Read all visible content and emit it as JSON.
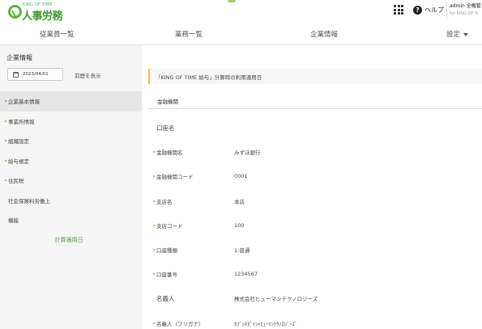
{
  "header": {
    "logo_small": "KING OF TIME",
    "logo_name": "人事労務",
    "help_label": "ヘルプ",
    "user_name": "admin 全権管",
    "user_sub": "for KING OF TI"
  },
  "nav": {
    "items": [
      "従業員一覧",
      "業務一覧",
      "企業情報",
      "設定"
    ]
  },
  "sidebar": {
    "title": "企業情報",
    "date": "2023/04/01",
    "past_link": "前歴を表示",
    "items": [
      {
        "label": "企業基本情報",
        "required": true,
        "active": true
      },
      {
        "label": "事業所情報",
        "required": true,
        "active": false
      },
      {
        "label": "組織設定",
        "required": true,
        "active": false
      },
      {
        "label": "給与規定",
        "required": true,
        "active": false
      },
      {
        "label": "住民税",
        "required": true,
        "active": false
      },
      {
        "label": "社会保険料労働上",
        "required": false,
        "active": false
      },
      {
        "label": "機能",
        "required": false,
        "active": false
      }
    ],
    "apply_link": "計算適用日"
  },
  "main": {
    "notice": "「KING OF TIME 給与」計算時の利用適用日",
    "section_title": "金融機関",
    "fields": [
      {
        "label": "口座名",
        "value": "",
        "required": false
      },
      {
        "label": "金融機関名",
        "value": "みずほ銀行",
        "required": true
      },
      {
        "label": "金融機関コード",
        "value": "0001",
        "required": true
      },
      {
        "label": "支店名",
        "value": "本店",
        "required": true
      },
      {
        "label": "支店コード",
        "value": "100",
        "required": true
      },
      {
        "label": "口座種類",
        "value": "1:普通",
        "required": true
      },
      {
        "label": "口座番号",
        "value": "1234567",
        "required": true
      },
      {
        "label": "名義人",
        "value": "株式会社ヒューマンテクノロジーズ",
        "required": false
      },
      {
        "label": "名義人（フリガナ）",
        "value": "ｶﾌﾞｼｷｶﾞｲｼｬﾋｭｰﾏﾝﾃｸﾉﾛｼﾞｰｽﾞ",
        "required": true
      }
    ]
  },
  "colors": {
    "brand_green": "#3d9a2c",
    "accent_orange": "#e8891c",
    "notice_bar": "#f0c14b"
  }
}
